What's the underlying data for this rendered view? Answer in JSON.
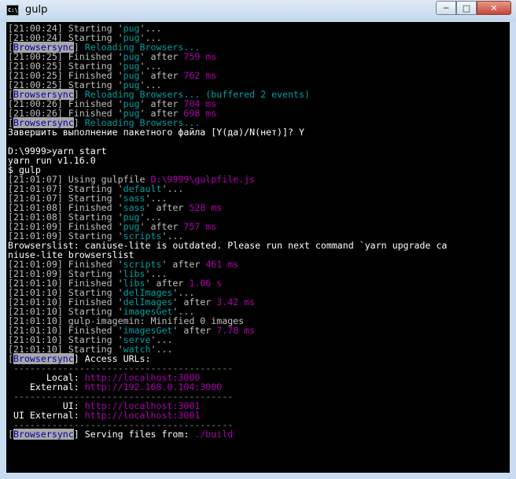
{
  "window": {
    "title": "gulp",
    "icon": "console-icon"
  },
  "lines": [
    [
      [
        "[21:00:24] ",
        "w"
      ],
      [
        "Starting '",
        "w"
      ],
      [
        "pug",
        "t"
      ],
      [
        "'...",
        "w"
      ]
    ],
    [
      [
        "[21:00:24] ",
        "w"
      ],
      [
        "Starting '",
        "w"
      ],
      [
        "pug",
        "t"
      ],
      [
        "'...",
        "w"
      ]
    ],
    [
      [
        "[",
        "w"
      ],
      [
        "Browsersync",
        "bs"
      ],
      [
        "] ",
        "w"
      ],
      [
        "Reloading Browsers...",
        "t"
      ]
    ],
    [
      [
        "[21:00:25] ",
        "w"
      ],
      [
        "Finished '",
        "w"
      ],
      [
        "pug",
        "t"
      ],
      [
        "' after ",
        "w"
      ],
      [
        "759 ms",
        "m"
      ]
    ],
    [
      [
        "[21:00:25] ",
        "w"
      ],
      [
        "Starting '",
        "w"
      ],
      [
        "pug",
        "t"
      ],
      [
        "'...",
        "w"
      ]
    ],
    [
      [
        "[21:00:25] ",
        "w"
      ],
      [
        "Finished '",
        "w"
      ],
      [
        "pug",
        "t"
      ],
      [
        "' after ",
        "w"
      ],
      [
        "762 ms",
        "m"
      ]
    ],
    [
      [
        "[21:00:25] ",
        "w"
      ],
      [
        "Starting '",
        "w"
      ],
      [
        "pug",
        "t"
      ],
      [
        "'...",
        "w"
      ]
    ],
    [
      [
        "[",
        "w"
      ],
      [
        "Browsersync",
        "bs"
      ],
      [
        "] ",
        "w"
      ],
      [
        "Reloading Browsers... (buffered 2 events)",
        "t"
      ]
    ],
    [
      [
        "[21:00:26] ",
        "w"
      ],
      [
        "Finished '",
        "w"
      ],
      [
        "pug",
        "t"
      ],
      [
        "' after ",
        "w"
      ],
      [
        "704 ms",
        "m"
      ]
    ],
    [
      [
        "[21:00:26] ",
        "w"
      ],
      [
        "Finished '",
        "w"
      ],
      [
        "pug",
        "t"
      ],
      [
        "' after ",
        "w"
      ],
      [
        "698 ms",
        "m"
      ]
    ],
    [
      [
        "[",
        "w"
      ],
      [
        "Browsersync",
        "bs"
      ],
      [
        "] ",
        "w"
      ],
      [
        "Reloading Browsers...",
        "t"
      ]
    ],
    [
      [
        "Завершить выполнение пакетного файла [Y(да)/N(нет)]? Y",
        "br"
      ]
    ],
    [
      [
        "",
        "w"
      ]
    ],
    [
      [
        "D:\\9999>yarn start",
        "br"
      ]
    ],
    [
      [
        "yarn run v1.16.0",
        "br"
      ]
    ],
    [
      [
        "$ gulp",
        "br"
      ]
    ],
    [
      [
        "[21:01:07] ",
        "w"
      ],
      [
        "Using gulpfile ",
        "w"
      ],
      [
        "D:\\9999\\gulpfile.js",
        "m"
      ]
    ],
    [
      [
        "[21:01:07] ",
        "w"
      ],
      [
        "Starting '",
        "w"
      ],
      [
        "default",
        "t"
      ],
      [
        "'...",
        "w"
      ]
    ],
    [
      [
        "[21:01:07] ",
        "w"
      ],
      [
        "Starting '",
        "w"
      ],
      [
        "sass",
        "t"
      ],
      [
        "'...",
        "w"
      ]
    ],
    [
      [
        "[21:01:08] ",
        "w"
      ],
      [
        "Finished '",
        "w"
      ],
      [
        "sass",
        "t"
      ],
      [
        "' after ",
        "w"
      ],
      [
        "528 ms",
        "m"
      ]
    ],
    [
      [
        "[21:01:08] ",
        "w"
      ],
      [
        "Starting '",
        "w"
      ],
      [
        "pug",
        "t"
      ],
      [
        "'...",
        "w"
      ]
    ],
    [
      [
        "[21:01:09] ",
        "w"
      ],
      [
        "Finished '",
        "w"
      ],
      [
        "pug",
        "t"
      ],
      [
        "' after ",
        "w"
      ],
      [
        "757 ms",
        "m"
      ]
    ],
    [
      [
        "[21:01:09] ",
        "w"
      ],
      [
        "Starting '",
        "w"
      ],
      [
        "scripts",
        "t"
      ],
      [
        "'...",
        "w"
      ]
    ],
    [
      [
        "Browserslist: caniuse-lite is outdated. Please run next command `yarn upgrade ca",
        "br"
      ]
    ],
    [
      [
        "niuse-lite browserslist",
        "br"
      ]
    ],
    [
      [
        "[21:01:09] ",
        "w"
      ],
      [
        "Finished '",
        "w"
      ],
      [
        "scripts",
        "t"
      ],
      [
        "' after ",
        "w"
      ],
      [
        "461 ms",
        "m"
      ]
    ],
    [
      [
        "[21:01:09] ",
        "w"
      ],
      [
        "Starting '",
        "w"
      ],
      [
        "libs",
        "t"
      ],
      [
        "'...",
        "w"
      ]
    ],
    [
      [
        "[21:01:10] ",
        "w"
      ],
      [
        "Finished '",
        "w"
      ],
      [
        "libs",
        "t"
      ],
      [
        "' after ",
        "w"
      ],
      [
        "1.06 s",
        "m"
      ]
    ],
    [
      [
        "[21:01:10] ",
        "w"
      ],
      [
        "Starting '",
        "w"
      ],
      [
        "delImages",
        "t"
      ],
      [
        "'...",
        "w"
      ]
    ],
    [
      [
        "[21:01:10] ",
        "w"
      ],
      [
        "Finished '",
        "w"
      ],
      [
        "delImages",
        "t"
      ],
      [
        "' after ",
        "w"
      ],
      [
        "3.42 ms",
        "m"
      ]
    ],
    [
      [
        "[21:01:10] ",
        "w"
      ],
      [
        "Starting '",
        "w"
      ],
      [
        "imagesGet",
        "t"
      ],
      [
        "'...",
        "w"
      ]
    ],
    [
      [
        "[21:01:10] ",
        "w"
      ],
      [
        "gulp-imagemin: Minified 0 images",
        "w"
      ]
    ],
    [
      [
        "[21:01:10] ",
        "w"
      ],
      [
        "Finished '",
        "w"
      ],
      [
        "imagesGet",
        "t"
      ],
      [
        "' after ",
        "w"
      ],
      [
        "7.78 ms",
        "m"
      ]
    ],
    [
      [
        "[21:01:10] ",
        "w"
      ],
      [
        "Starting '",
        "w"
      ],
      [
        "serve",
        "t"
      ],
      [
        "'...",
        "w"
      ]
    ],
    [
      [
        "[21:01:10] ",
        "w"
      ],
      [
        "Starting '",
        "w"
      ],
      [
        "watch",
        "t"
      ],
      [
        "'...",
        "w"
      ]
    ],
    [
      [
        "[",
        "w"
      ],
      [
        "Browsersync",
        "bs"
      ],
      [
        "] ",
        "br"
      ],
      [
        "Access URLs:",
        "br"
      ]
    ],
    [
      [
        " ----------------------------------------",
        "dim"
      ]
    ],
    [
      [
        "       Local: ",
        "br"
      ],
      [
        "http://localhost:3000",
        "m"
      ]
    ],
    [
      [
        "    External: ",
        "br"
      ],
      [
        "http://192.168.0.104:3000",
        "m"
      ]
    ],
    [
      [
        " ----------------------------------------",
        "dim"
      ]
    ],
    [
      [
        "          UI: ",
        "br"
      ],
      [
        "http://localhost:3001",
        "m"
      ]
    ],
    [
      [
        " UI External: ",
        "br"
      ],
      [
        "http://localhost:3001",
        "m"
      ]
    ],
    [
      [
        " ----------------------------------------",
        "dim"
      ]
    ],
    [
      [
        "[",
        "w"
      ],
      [
        "Browsersync",
        "bs"
      ],
      [
        "] ",
        "br"
      ],
      [
        "Serving files from: ",
        "br"
      ],
      [
        "./build",
        "m"
      ]
    ]
  ]
}
